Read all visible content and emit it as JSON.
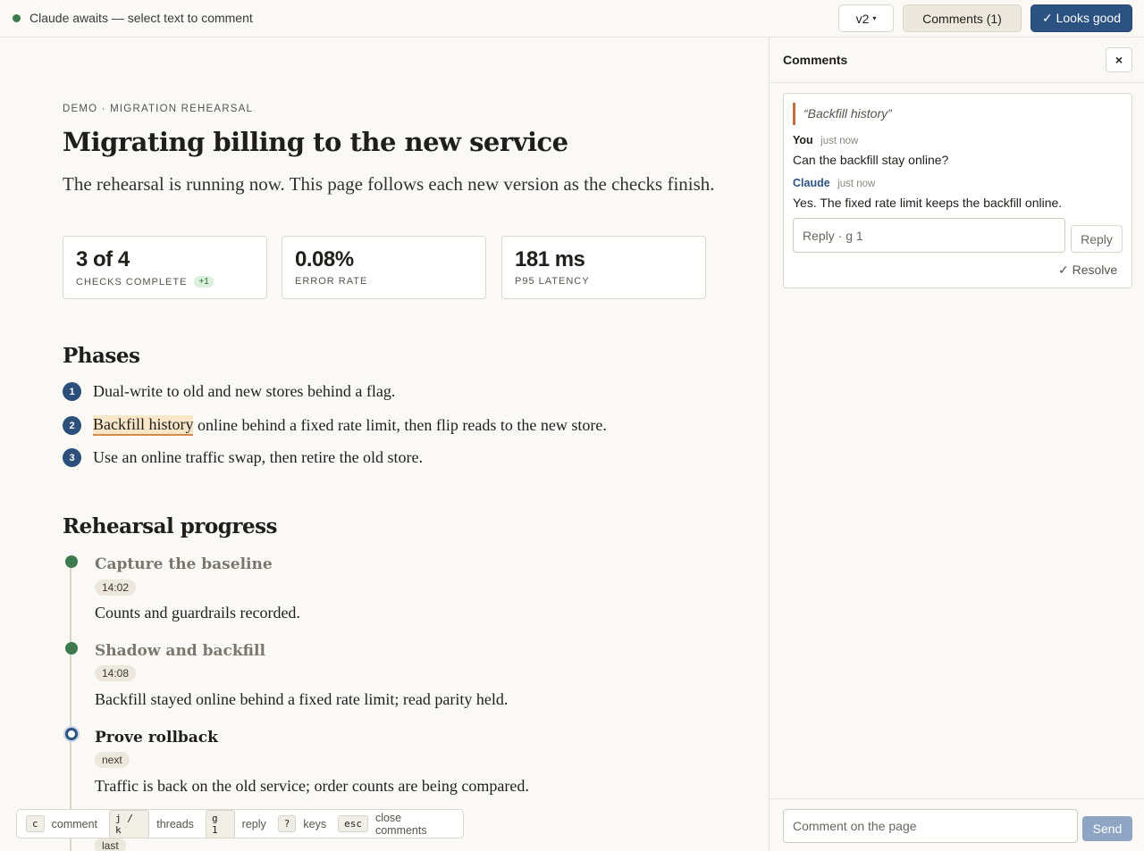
{
  "topbar": {
    "status_text": "Claude awaits — select text to comment",
    "version_label": "v2",
    "version_caret": "▾",
    "comments_label": "Comments (1)",
    "looks_good_label": "✓ Looks good"
  },
  "doc": {
    "eyebrow": "DEMO · MIGRATION REHEARSAL",
    "title": "Migrating billing to the new service",
    "lede": "The rehearsal is running now. This page follows each new version as the checks finish.",
    "stats": [
      {
        "value": "3 of 4",
        "label": "CHECKS COMPLETE",
        "delta": "+1"
      },
      {
        "value": "0.08%",
        "label": "ERROR RATE"
      },
      {
        "value": "181 ms",
        "label": "P95 LATENCY"
      }
    ],
    "phases_heading": "Phases",
    "phases": [
      {
        "num": "1",
        "text": "Dual-write to old and new stores behind a flag."
      },
      {
        "num": "2",
        "highlight": "Backfill history",
        "text": " online behind a fixed rate limit, then flip reads to the new store."
      },
      {
        "num": "3",
        "text": "Use an online traffic swap, then retire the old store."
      }
    ],
    "progress_heading": "Rehearsal progress",
    "steps": [
      {
        "title": "Capture the baseline",
        "time": "14:02",
        "body": "Counts and guardrails recorded."
      },
      {
        "title": "Shadow and backfill",
        "time": "14:08",
        "body": "Backfill stayed online behind a fixed rate limit; read parity held."
      },
      {
        "title": "Prove rollback",
        "time": "next",
        "body": "Traffic is back on the old service; order counts are being compared."
      },
      {
        "title": "",
        "time": "last",
        "body": ""
      }
    ]
  },
  "shortcuts": [
    {
      "key": "c",
      "desc": "comment"
    },
    {
      "key": "j / k",
      "desc": "threads"
    },
    {
      "key": "g 1",
      "desc": "reply"
    },
    {
      "key": "?",
      "desc": "keys"
    },
    {
      "key": "esc",
      "desc": "close comments"
    }
  ],
  "panel": {
    "title": "Comments",
    "close": "×",
    "thread": {
      "quote": "“Backfill history”",
      "messages": [
        {
          "author": "You",
          "when": "just now",
          "text": "Can the backfill stay online?"
        },
        {
          "author": "Claude",
          "when": "just now",
          "text": "Yes. The fixed rate limit keeps the backfill online."
        }
      ],
      "reply_placeholder": "Reply · g 1",
      "reply_label": "Reply",
      "resolve_label": "✓ Resolve"
    },
    "composer_placeholder": "Comment on the page",
    "send_label": "Send"
  },
  "colors": {
    "accent": "#2c5282",
    "done": "#3e7a4d",
    "highlight": "#f8e6c8"
  }
}
